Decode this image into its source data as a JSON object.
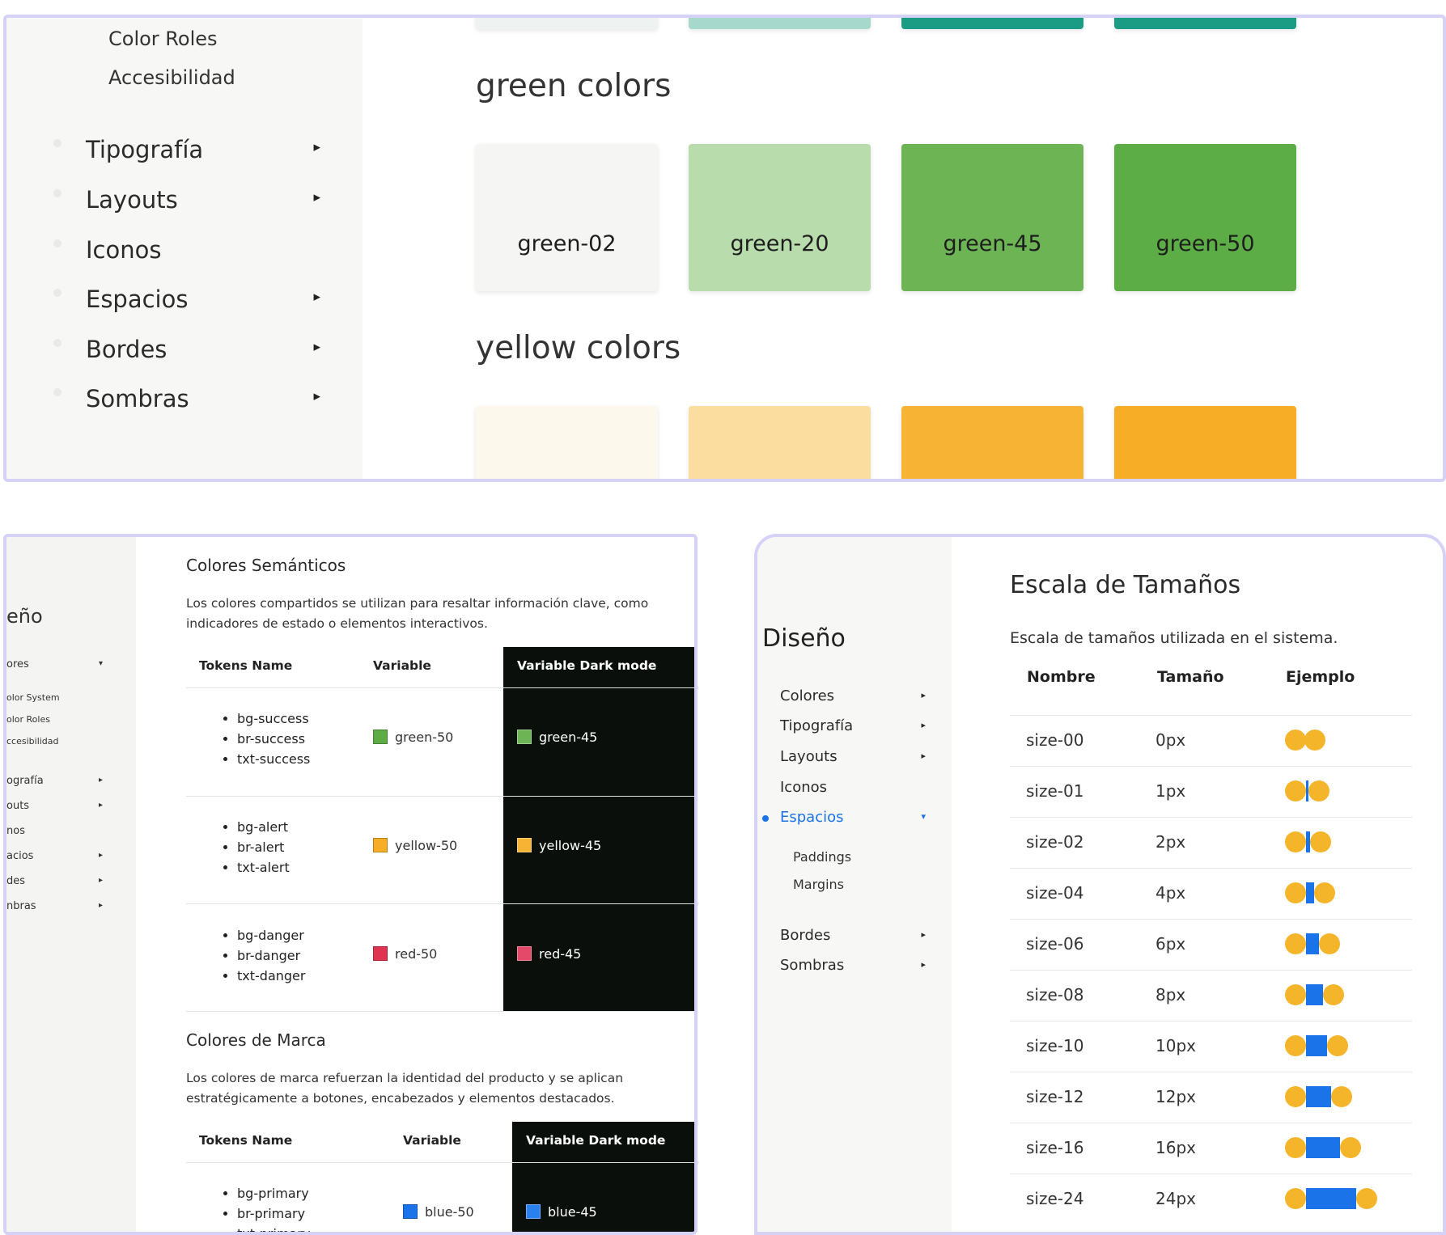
{
  "panel1": {
    "sub_items": [
      "Color Roles",
      "Accesibilidad"
    ],
    "nav": [
      {
        "label": "Tipografía",
        "arrow": "▸"
      },
      {
        "label": "Layouts",
        "arrow": "▸"
      },
      {
        "label": "Iconos",
        "arrow": ""
      },
      {
        "label": "Espacios",
        "arrow": "▸"
      },
      {
        "label": "Bordes",
        "arrow": "▸"
      },
      {
        "label": "Sombras",
        "arrow": "▸"
      }
    ],
    "green_title": "green colors",
    "yellow_title": "yellow colors",
    "green_swatches": [
      {
        "label": "green-02",
        "color": "#f5f6f3"
      },
      {
        "label": "green-20",
        "color": "#b9dcad"
      },
      {
        "label": "green-45",
        "color": "#6db454"
      },
      {
        "label": "green-50",
        "color": "#5cad45"
      }
    ],
    "teal_swatches": [
      "#eef3f1",
      "#a6d8cb",
      "#1a9c84",
      "#1a9c84"
    ],
    "yellow_swatches": [
      "#fdf8ec",
      "#fbdda0",
      "#f7b334",
      "#f7ad26"
    ]
  },
  "panel2": {
    "sidebar": {
      "section": "eño",
      "items": [
        {
          "label": "ores",
          "arrow": "▾"
        },
        {
          "label": "olor System",
          "arrow": ""
        },
        {
          "label": "olor Roles",
          "arrow": ""
        },
        {
          "label": "ccesibilidad",
          "arrow": ""
        },
        {
          "label": "ografía",
          "arrow": "▸"
        },
        {
          "label": "outs",
          "arrow": "▸"
        },
        {
          "label": "nos",
          "arrow": ""
        },
        {
          "label": "acios",
          "arrow": "▸"
        },
        {
          "label": "des",
          "arrow": "▸"
        },
        {
          "label": "nbras",
          "arrow": "▸"
        }
      ]
    },
    "semantic": {
      "title": "Colores Semánticos",
      "desc_lines": [
        "Los colores compartidos se utilizan para resaltar información clave, como",
        "indicadores de estado o elementos interactivos."
      ],
      "headers": [
        "Tokens Name",
        "Variable",
        "Variable Dark mode"
      ],
      "rows": [
        {
          "tokens": [
            "bg-success",
            "br-success",
            "txt-success"
          ],
          "var": "green-50",
          "var_color": "#5cad45",
          "dark": "green-45",
          "dark_color": "#6db454"
        },
        {
          "tokens": [
            "bg-alert",
            "br-alert",
            "txt-alert"
          ],
          "var": "yellow-50",
          "var_color": "#f7ad26",
          "dark": "yellow-45",
          "dark_color": "#f7b334"
        },
        {
          "tokens": [
            "bg-danger",
            "br-danger",
            "txt-danger"
          ],
          "var": "red-50",
          "var_color": "#e0334f",
          "dark": "red-45",
          "dark_color": "#e5496a"
        }
      ]
    },
    "brand": {
      "title": "Colores de Marca",
      "desc_lines": [
        "Los colores de marca refuerzan la identidad del producto y se aplican",
        "estratégicamente a botones, encabezados y elementos destacados."
      ],
      "headers": [
        "Tokens Name",
        "Variable",
        "Variable Dark mode"
      ],
      "rows": [
        {
          "tokens": [
            "bg-primary",
            "br-primary",
            "txt-primary"
          ],
          "var": "blue-50",
          "var_color": "#1a73e8",
          "dark": "blue-45",
          "dark_color": "#2b80f0"
        }
      ]
    }
  },
  "panel3": {
    "sidebar": {
      "title": "Diseño",
      "items": [
        {
          "label": "Colores",
          "arrow": "▸",
          "active": false
        },
        {
          "label": "Tipografía",
          "arrow": "▸",
          "active": false
        },
        {
          "label": "Layouts",
          "arrow": "▸",
          "active": false
        },
        {
          "label": "Iconos",
          "arrow": "",
          "active": false
        },
        {
          "label": "Espacios",
          "arrow": "▾",
          "active": true
        },
        {
          "label": "Bordes",
          "arrow": "▸",
          "active": false
        },
        {
          "label": "Sombras",
          "arrow": "▸",
          "active": false
        }
      ],
      "sub_items": [
        "Paddings",
        "Margins"
      ]
    },
    "title": "Escala de Tamaños",
    "desc": "Escala de tamaños utilizada en el sistema.",
    "headers": [
      "Nombre",
      "Tamaño",
      "Ejemplo"
    ],
    "rows": [
      {
        "name": "size-00",
        "size": "0px",
        "value": 0
      },
      {
        "name": "size-01",
        "size": "1px",
        "value": 1
      },
      {
        "name": "size-02",
        "size": "2px",
        "value": 2
      },
      {
        "name": "size-04",
        "size": "4px",
        "value": 4
      },
      {
        "name": "size-06",
        "size": "6px",
        "value": 6
      },
      {
        "name": "size-08",
        "size": "8px",
        "value": 8
      },
      {
        "name": "size-10",
        "size": "10px",
        "value": 10
      },
      {
        "name": "size-12",
        "size": "12px",
        "value": 12
      },
      {
        "name": "size-16",
        "size": "16px",
        "value": 16
      },
      {
        "name": "size-24",
        "size": "24px",
        "value": 24
      }
    ],
    "accent_color": "#1a73e8",
    "circle_color": "#f5b52a"
  }
}
